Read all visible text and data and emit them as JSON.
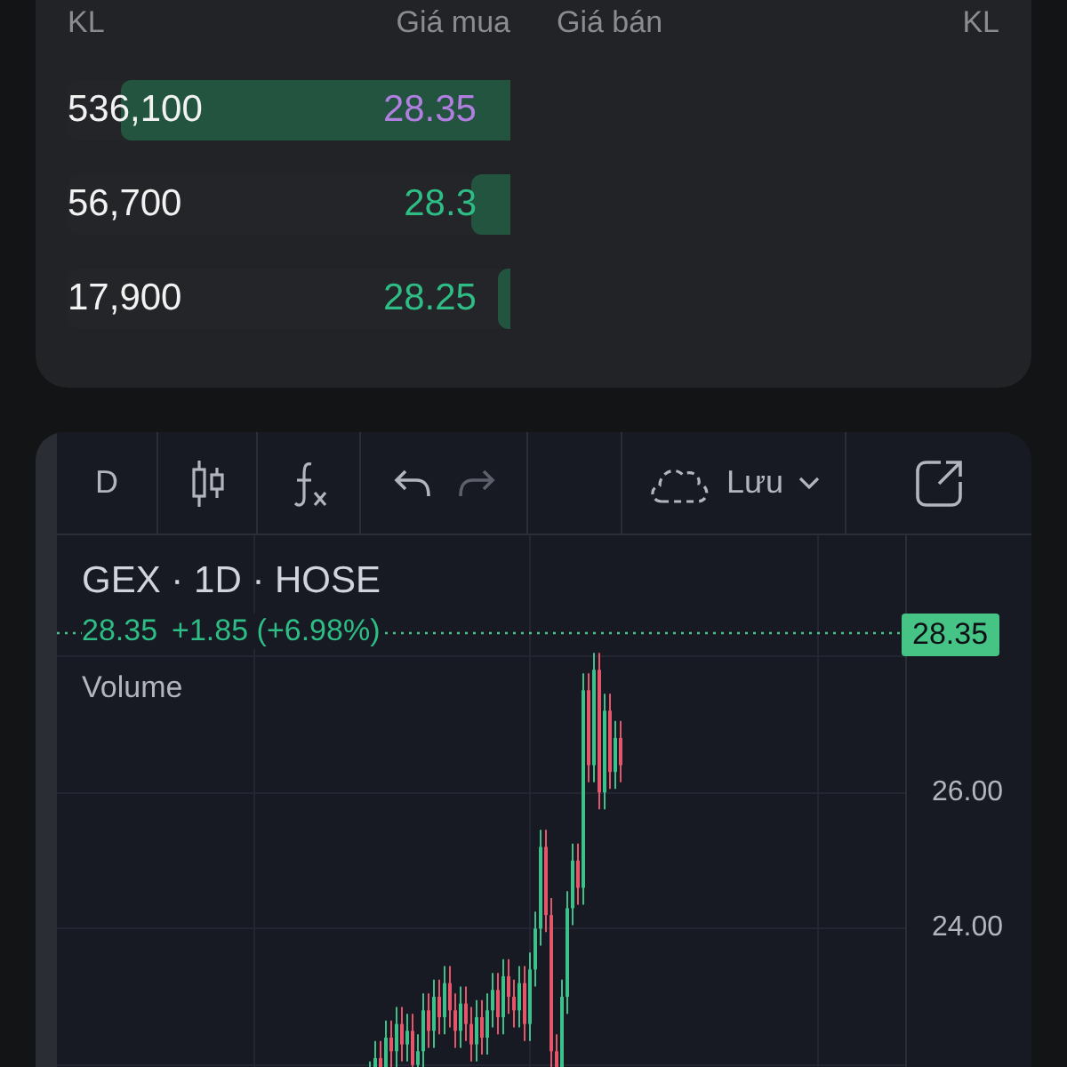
{
  "orderbook": {
    "headers": [
      "KL",
      "Giá mua",
      "Giá bán",
      "KL"
    ],
    "bids": [
      {
        "volume": "536,100",
        "price": "28.35",
        "color": "#b07fe0",
        "level": 0.88
      },
      {
        "volume": "56,700",
        "price": "28.3",
        "color": "#2ebd85",
        "level": 0.09
      },
      {
        "volume": "17,900",
        "price": "28.25",
        "color": "#2ebd85",
        "level": 0.03
      }
    ]
  },
  "toolbar": {
    "interval": "D",
    "save_label": "Lưu"
  },
  "chart": {
    "legend": {
      "title": "GEX · 1D · HOSE",
      "price": "28.35",
      "change": "+1.85 (+6.98%)",
      "indicator": "Volume"
    },
    "price_tag": "28.35",
    "y_labels": [
      "26.00",
      "24.00"
    ]
  }
}
